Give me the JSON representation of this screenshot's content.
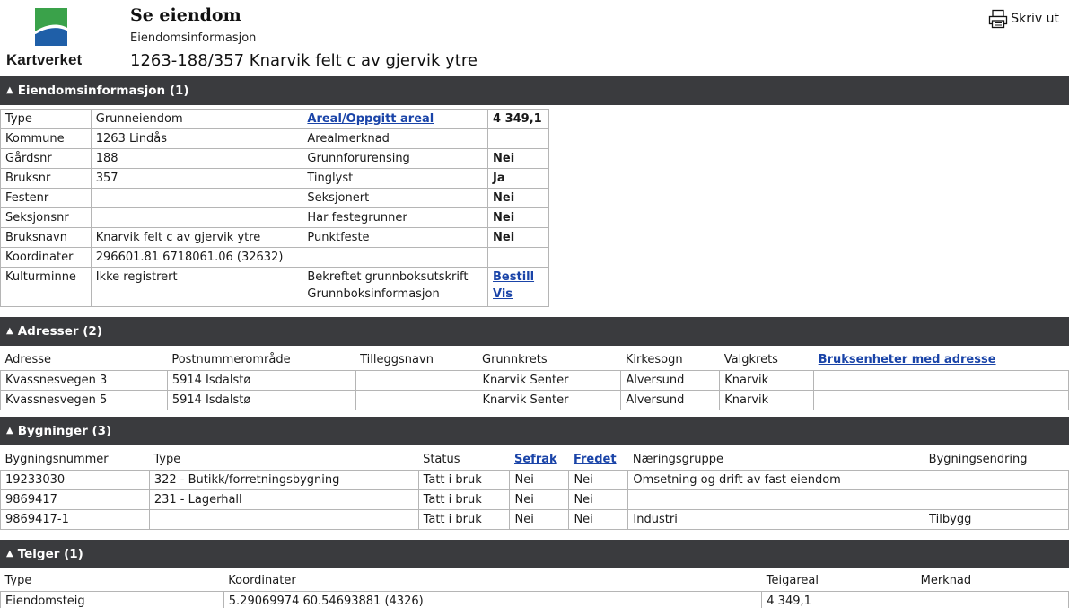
{
  "header": {
    "logo_text": "Kartverket",
    "title": "Se eiendom",
    "subtitle": "Eiendomsinformasjon",
    "property_title": "1263-188/357 Knarvik felt c av gjervik ytre",
    "print_label": "Skriv ut"
  },
  "colors": {
    "section_bar": "#3a3b3e",
    "link": "#1a44a8",
    "logo_blue": "#1f5fa8",
    "logo_green": "#3aa24a"
  },
  "sections": {
    "eiendom": "Eiendomsinformasjon (1)",
    "adresser": "Adresser (2)",
    "bygninger": "Bygninger (3)",
    "teiger": "Teiger (1)"
  },
  "eiendom": {
    "rows": [
      [
        "Type",
        "Grunneiendom",
        "Areal/Oppgitt areal",
        "4 349,1"
      ],
      [
        "Kommune",
        "1263 Lindås",
        "Arealmerknad",
        ""
      ],
      [
        "Gårdsnr",
        "188",
        "Grunnforurensing",
        "Nei"
      ],
      [
        "Bruksnr",
        "357",
        "Tinglyst",
        "Ja"
      ],
      [
        "Festenr",
        "",
        "Seksjonert",
        "Nei"
      ],
      [
        "Seksjonsnr",
        "",
        "Har festegrunner",
        "Nei"
      ],
      [
        "Bruksnavn",
        "Knarvik felt c av gjervik ytre",
        "Punktfeste",
        "Nei"
      ],
      [
        "Koordinater",
        "296601.81 6718061.06 (32632)",
        "",
        ""
      ]
    ],
    "kulturminne_label": "Kulturminne",
    "kulturminne_value": "Ikke registrert",
    "grunnbok_line1": "Bekreftet grunnboksutskrift",
    "grunnbok_line2": "Grunnboksinformasjon",
    "bestill_label": "Bestill",
    "vis_label": "Vis"
  },
  "adresser": {
    "headers": [
      "Adresse",
      "Postnummerområde",
      "Tilleggsnavn",
      "Grunnkrets",
      "Kirkesogn",
      "Valgkrets",
      "Bruksenheter med adresse"
    ],
    "rows": [
      [
        "Kvassnesvegen 3",
        "5914 Isdalstø",
        "",
        "Knarvik Senter",
        "Alversund",
        "Knarvik",
        ""
      ],
      [
        "Kvassnesvegen 5",
        "5914 Isdalstø",
        "",
        "Knarvik Senter",
        "Alversund",
        "Knarvik",
        ""
      ]
    ]
  },
  "bygninger": {
    "headers": [
      "Bygningsnummer",
      "Type",
      "Status",
      "Sefrak",
      "Fredet",
      "Næringsgruppe",
      "Bygningsendring"
    ],
    "rows": [
      [
        "19233030",
        "322 - Butikk/forretningsbygning",
        "Tatt i bruk",
        "Nei",
        "Nei",
        "Omsetning og drift av fast eiendom",
        ""
      ],
      [
        "9869417",
        "231 - Lagerhall",
        "Tatt i bruk",
        "Nei",
        "Nei",
        "",
        ""
      ],
      [
        "9869417-1",
        "",
        "Tatt i bruk",
        "Nei",
        "Nei",
        "Industri",
        "Tilbygg"
      ]
    ]
  },
  "teiger": {
    "headers": [
      "Type",
      "Koordinater",
      "Teigareal",
      "Merknad"
    ],
    "rows": [
      [
        "Eiendomsteig",
        "5.29069974 60.54693881 (4326)",
        "4 349,1",
        ""
      ]
    ]
  }
}
